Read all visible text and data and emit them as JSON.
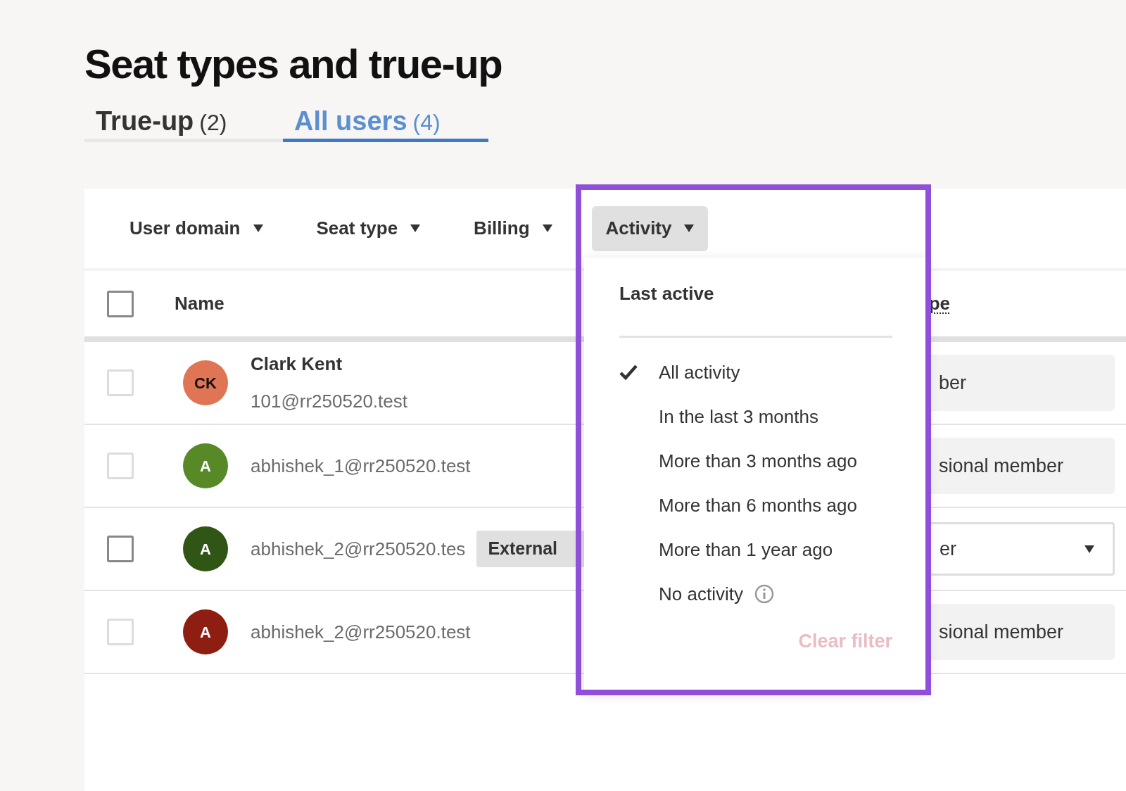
{
  "title": "Seat types and true-up",
  "tabs": [
    {
      "label": "True-up",
      "count": "(2)",
      "selected": false
    },
    {
      "label": "All users",
      "count": "(4)",
      "selected": true
    }
  ],
  "filters": [
    {
      "label": "User domain",
      "open": false
    },
    {
      "label": "Seat type",
      "open": false
    },
    {
      "label": "Billing",
      "open": false
    },
    {
      "label": "Activity",
      "open": true
    }
  ],
  "table": {
    "select_all": {
      "checked": false
    },
    "columns": [
      "Name",
      "pe"
    ],
    "rows": [
      {
        "checked": false,
        "disabled": true,
        "initials": "CK",
        "color": "#e07555",
        "name": "Clark Kent",
        "email": "101@rr250520.test",
        "seat": {
          "kind": "static",
          "text": "ber"
        }
      },
      {
        "checked": false,
        "disabled": true,
        "initials": "A",
        "color": "#578a27",
        "email": "abhishek_1@rr250520.test",
        "seat": {
          "kind": "static",
          "text": "sional member"
        }
      },
      {
        "checked": false,
        "disabled": false,
        "initials": "A",
        "color": "#2f5614",
        "email": "abhishek_2@rr250520.tes",
        "badge": "External",
        "seat": {
          "kind": "select",
          "text": "er"
        }
      },
      {
        "checked": false,
        "disabled": true,
        "initials": "A",
        "color": "#8e1d12",
        "email": "abhishek_2@rr250520.test",
        "seat": {
          "kind": "static",
          "text": "sional member"
        }
      }
    ]
  },
  "activity_menu": {
    "heading": "Last active",
    "options": [
      {
        "label": "All activity",
        "selected": true,
        "info": false
      },
      {
        "label": "In the last 3 months",
        "selected": false,
        "info": false
      },
      {
        "label": "More than 3 months ago",
        "selected": false,
        "info": false
      },
      {
        "label": "More than 6 months ago",
        "selected": false,
        "info": false
      },
      {
        "label": "More than 1 year ago",
        "selected": false,
        "info": false
      },
      {
        "label": "No activity",
        "selected": false,
        "info": true
      }
    ],
    "clear_filter": {
      "label": "Clear filter",
      "disabled": true
    }
  }
}
